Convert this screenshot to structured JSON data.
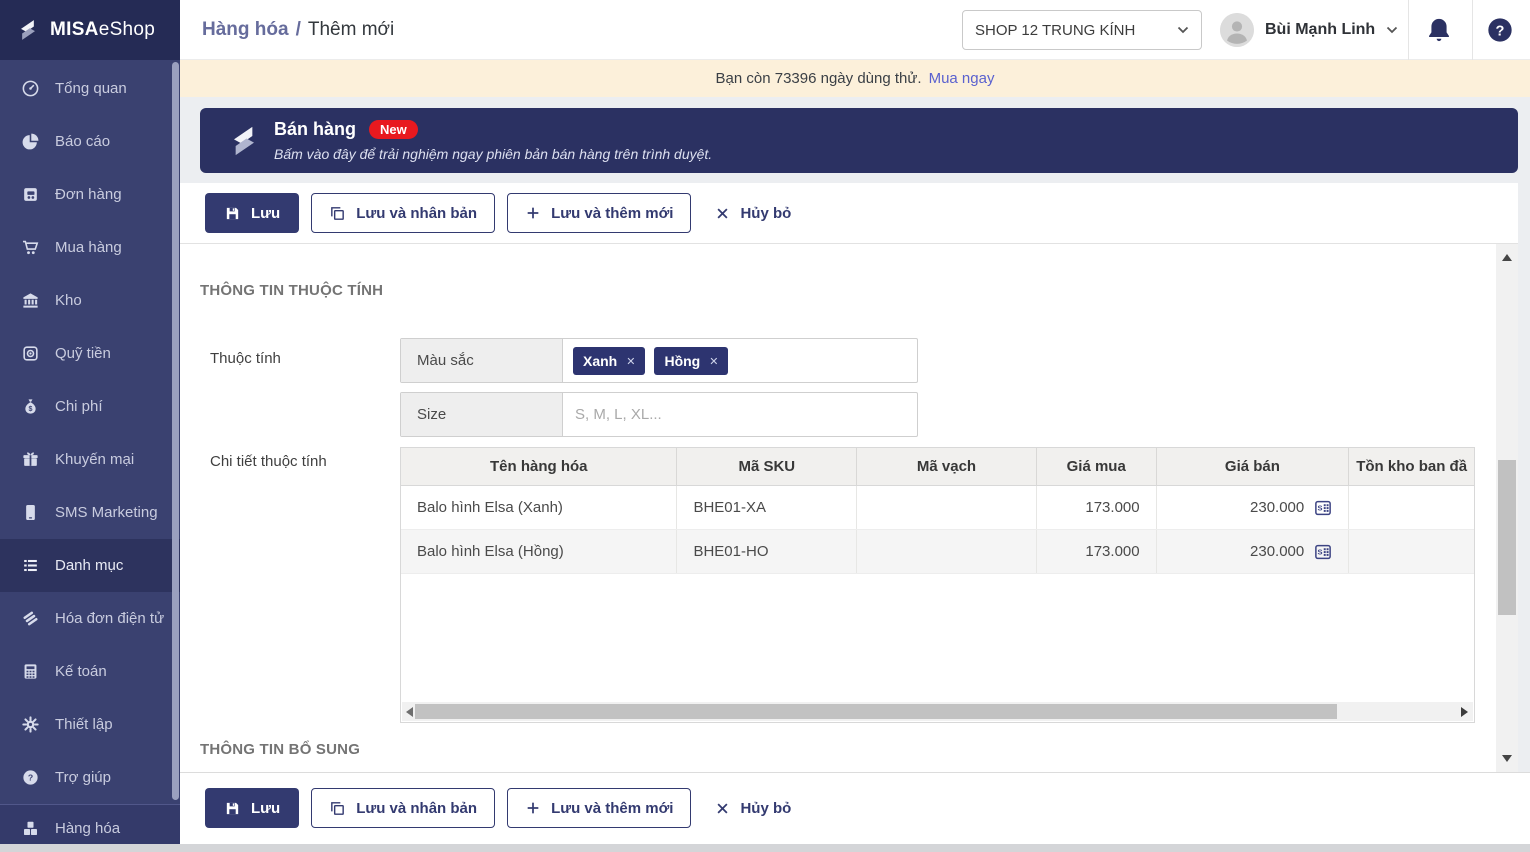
{
  "sidebar": {
    "logo": {
      "bold": "MISA",
      "light": "eShop"
    },
    "items": [
      {
        "label": "Tổng quan",
        "icon": "dashboard-icon"
      },
      {
        "label": "Báo cáo",
        "icon": "pie-chart-icon"
      },
      {
        "label": "Đơn hàng",
        "icon": "orders-icon"
      },
      {
        "label": "Mua hàng",
        "icon": "cart-icon"
      },
      {
        "label": "Kho",
        "icon": "warehouse-icon"
      },
      {
        "label": "Quỹ tiền",
        "icon": "safe-icon"
      },
      {
        "label": "Chi phí",
        "icon": "money-bag-icon"
      },
      {
        "label": "Khuyến mại",
        "icon": "gift-icon"
      },
      {
        "label": "SMS Marketing",
        "icon": "phone-icon"
      },
      {
        "label": "Danh mục",
        "icon": "list-icon",
        "active": true
      },
      {
        "label": "Hóa đơn điện tử",
        "icon": "e-invoice-icon"
      },
      {
        "label": "Kế toán",
        "icon": "calculator-icon"
      },
      {
        "label": "Thiết lập",
        "icon": "gear-icon"
      },
      {
        "label": "Trợ giúp",
        "icon": "help-icon"
      }
    ],
    "bottom_item": {
      "label": "Hàng hóa",
      "icon": "boxes-icon"
    }
  },
  "header": {
    "breadcrumb": {
      "parent": "Hàng hóa",
      "separator": "/",
      "current": "Thêm mới"
    },
    "shop_selector": {
      "value": "SHOP 12 TRUNG KÍNH"
    },
    "user": {
      "name": "Bùi Mạnh Linh"
    }
  },
  "trial_banner": {
    "text": "Bạn còn 73396 ngày dùng thử.",
    "link_label": "Mua ngay"
  },
  "promo_banner": {
    "title": "Bán hàng",
    "badge": "New",
    "subtitle": "Bấm vào đây để trải nghiệm ngay phiên bản bán hàng trên trình duyệt."
  },
  "actions": {
    "save": "Lưu",
    "save_and_duplicate": "Lưu và nhân bản",
    "save_and_new": "Lưu và thêm mới",
    "cancel": "Hủy bỏ"
  },
  "attribute_section": {
    "title": "THÔNG TIN THUỘC TÍNH",
    "attributes_label": "Thuộc tính",
    "attribute_rows": [
      {
        "name": "Màu sắc",
        "tags": [
          {
            "label": "Xanh"
          },
          {
            "label": "Hồng"
          }
        ]
      },
      {
        "name": "Size",
        "placeholder": "S, M, L, XL..."
      }
    ],
    "detail_label": "Chi tiết thuộc tính",
    "table": {
      "columns": [
        "Tên hàng hóa",
        "Mã SKU",
        "Mã vạch",
        "Giá mua",
        "Giá bán",
        "Tồn kho ban đầ"
      ],
      "rows": [
        {
          "name": "Balo hình Elsa (Xanh)",
          "sku": "BHE01-XA",
          "barcode": "",
          "purchase_price": "173.000",
          "sale_price": "230.000"
        },
        {
          "name": "Balo hình Elsa (Hồng)",
          "sku": "BHE01-HO",
          "barcode": "",
          "purchase_price": "173.000",
          "sale_price": "230.000"
        }
      ]
    }
  },
  "additional_section": {
    "title": "THÔNG TIN BỔ SUNG"
  },
  "colors": {
    "primary_navy": "#333a70",
    "sidebar_bg": "#3a4170",
    "sidebar_active_bg": "#2d335e",
    "promo_bg": "#2b3162",
    "badge_red": "#e8191f",
    "trial_bg": "#fcf0da",
    "link_purple": "#5a61cf",
    "content_bg": "#eceef1"
  }
}
